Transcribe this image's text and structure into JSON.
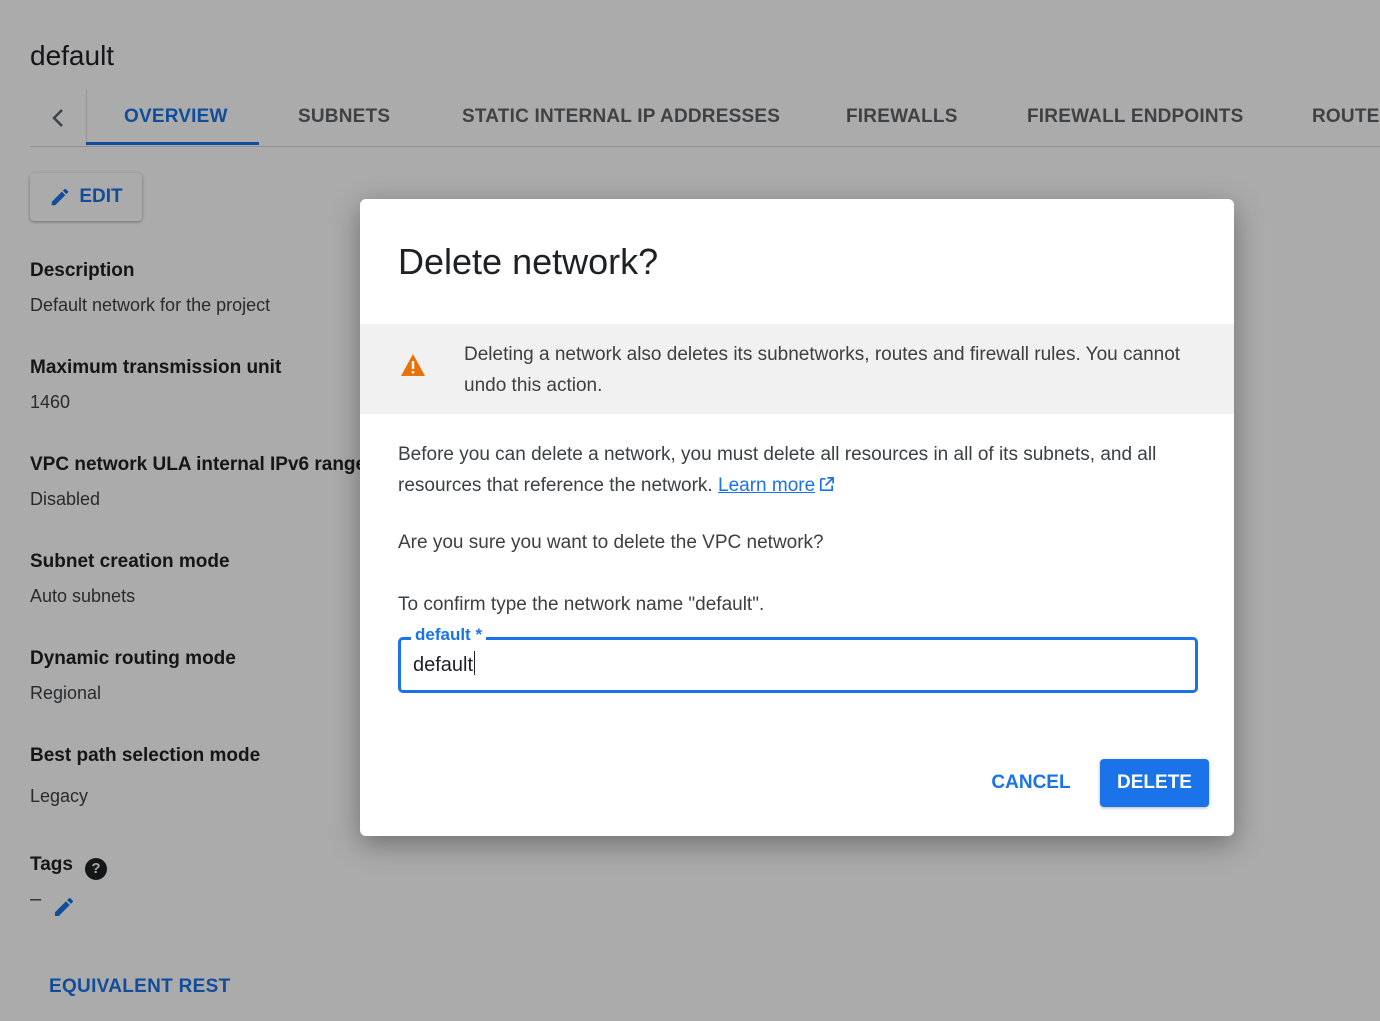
{
  "page": {
    "title": "default",
    "tabs": [
      {
        "label": "OVERVIEW",
        "active": true
      },
      {
        "label": "SUBNETS"
      },
      {
        "label": "STATIC INTERNAL IP ADDRESSES"
      },
      {
        "label": "FIREWALLS"
      },
      {
        "label": "FIREWALL ENDPOINTS"
      },
      {
        "label": "ROUTES"
      }
    ],
    "edit_label": "EDIT",
    "details": [
      {
        "label": "Description",
        "value": "Default network for the project"
      },
      {
        "label": "Maximum transmission unit",
        "value": "1460"
      },
      {
        "label": "VPC network ULA internal IPv6 range",
        "value": "Disabled"
      },
      {
        "label": "Subnet creation mode",
        "value": "Auto subnets"
      },
      {
        "label": "Dynamic routing mode",
        "value": "Regional"
      },
      {
        "label": "Best path selection mode",
        "value": "Legacy"
      }
    ],
    "tags_label": "Tags",
    "tags_value": "–",
    "equivalent_rest": "EQUIVALENT REST"
  },
  "dialog": {
    "title": "Delete network?",
    "warning": "Deleting a network also deletes its subnetworks, routes and firewall rules. You cannot undo this action.",
    "body": "Before you can delete a network, you must delete all resources in all of its subnets, and all resources that reference the network.",
    "learn_more": "Learn more",
    "confirm_question": "Are you sure you want to delete the VPC network?",
    "confirm_instruction": "To confirm type the network name \"default\".",
    "field_label": "default *",
    "field_value": "default",
    "cancel_label": "CANCEL",
    "delete_label": "DELETE"
  },
  "colors": {
    "accent": "#1a73e8",
    "warning": "#e8710a",
    "scrim": "rgba(0,0,0,0.33)"
  }
}
